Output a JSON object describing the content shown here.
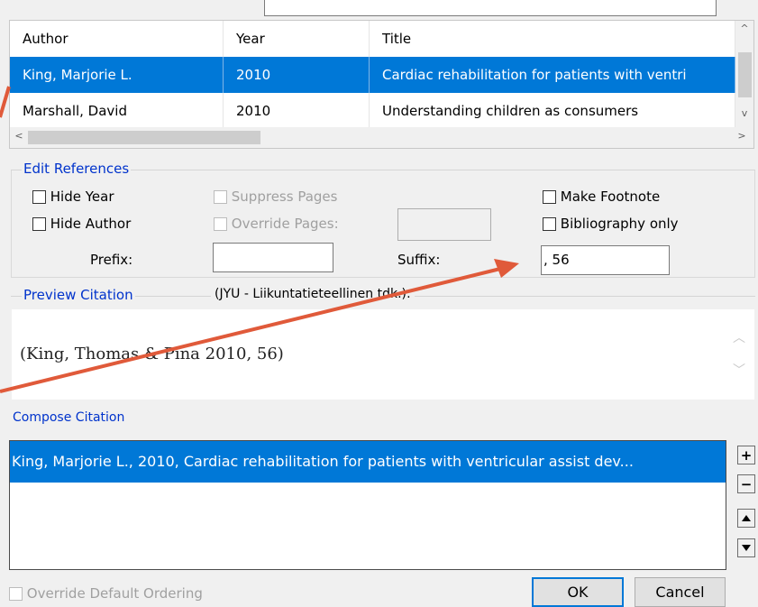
{
  "reference_list": {
    "columns": [
      "Author",
      "Year",
      "Title"
    ],
    "rows": [
      {
        "author": "King, Marjorie L.",
        "year": "2010",
        "title": "Cardiac rehabilitation for patients with ventri",
        "selected": true
      },
      {
        "author": "Marshall, David",
        "year": "2010",
        "title": "Understanding children as consumers",
        "selected": false
      }
    ],
    "scroll_up": "^",
    "scroll_down": "v",
    "scroll_left": "<",
    "scroll_right": ">"
  },
  "edit_references": {
    "title": "Edit References",
    "hide_year": "Hide Year",
    "hide_author": "Hide Author",
    "suppress_pages": "Suppress Pages",
    "override_pages": "Override Pages:",
    "make_footnote": "Make Footnote",
    "bibliography_only": "Bibliography only",
    "prefix_label": "Prefix:",
    "prefix_value": "",
    "suffix_label": "Suffix:",
    "suffix_value": ", 56"
  },
  "preview": {
    "title": "Preview Citation",
    "style": "(JYU - Liikuntatieteellinen tdk.):",
    "text": "(King, Thomas & Pina 2010, 56)"
  },
  "compose": {
    "title": "Compose Citation",
    "items": [
      "King, Marjorie L., 2010, Cardiac rehabilitation for patients with ventricular assist dev..."
    ],
    "add": "+",
    "remove": "−"
  },
  "footer": {
    "override_ordering": "Override Default Ordering",
    "ok": "OK",
    "cancel": "Cancel"
  },
  "colors": {
    "selection": "#0078d7",
    "group_title": "#0033cc",
    "annotation_arrow": "#e05a3a"
  }
}
